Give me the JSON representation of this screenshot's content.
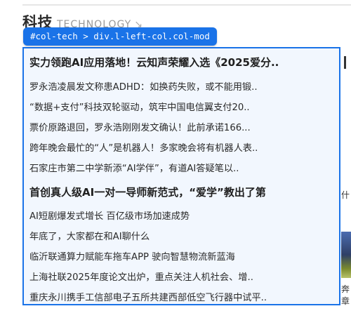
{
  "section": {
    "title": "科技",
    "subtitle": "TECHNOLOGY",
    "arrow_icon": "arrow-icon"
  },
  "inspector": {
    "label": "#col-tech > div.l-left-col.col-mod"
  },
  "news": {
    "headline_1": "实力领跑AI应用落地！云知声荣耀入选《2025爱分..",
    "items_1": [
      "罗永浩凌晨发文称患ADHD：如换药失败，或不能用锻..",
      "“数据+支付”科技双轮驱动，筑牢中国电信翼支付20..",
      "票价原路退回，罗永浩刚刚发文确认！此前承诺166...",
      "跨年晚会最忙的“人”是机器人！多家晚会将有机器人表..",
      "石家庄市第二中学新添“AI学伴”，有道AI答疑笔以.."
    ],
    "headline_2": "首创真人级AI一对一导师新范式，“爱学”教出了第",
    "items_2": [
      "AI短剧爆发式增长 百亿级市场加速成势",
      "年底了，大家都在和AI聊什么",
      "临沂联通算力赋能车拖车APP 驶向智慧物流新蓝海",
      "上海社联2025年度论文出炉，重点关注人机社会、增..",
      "重庆永川携手工信部电子五所共建西部低空飞行器中试平.."
    ]
  },
  "right_column": {
    "text_1": "什",
    "text_2": "奔",
    "text_3": "章"
  },
  "colors": {
    "accent": "#1a73e8",
    "headline_marker": "#d24a4a"
  }
}
